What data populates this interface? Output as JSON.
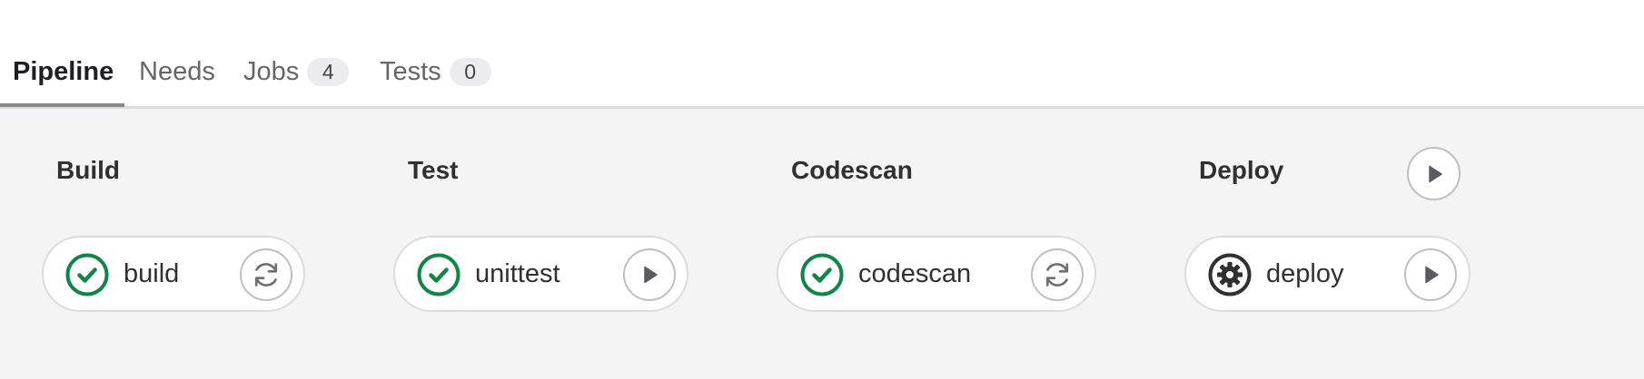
{
  "tabs": [
    {
      "label": "Pipeline",
      "active": true
    },
    {
      "label": "Needs"
    },
    {
      "label": "Jobs",
      "badge": "4"
    },
    {
      "label": "Tests",
      "badge": "0"
    }
  ],
  "stages": [
    {
      "title": "Build",
      "jobs": [
        {
          "name": "build",
          "status": "success",
          "status_icon": "check-circle-icon",
          "action_icon": "retry-icon"
        }
      ]
    },
    {
      "title": "Test",
      "jobs": [
        {
          "name": "unittest",
          "status": "success",
          "status_icon": "check-circle-icon",
          "action_icon": "play-icon"
        }
      ]
    },
    {
      "title": "Codescan",
      "jobs": [
        {
          "name": "codescan",
          "status": "success",
          "status_icon": "check-circle-icon",
          "action_icon": "retry-icon"
        }
      ]
    },
    {
      "title": "Deploy",
      "stage_action_icon": "play-icon",
      "jobs": [
        {
          "name": "deploy",
          "status": "manual",
          "status_icon": "gear-icon",
          "action_icon": "play-icon"
        }
      ]
    }
  ],
  "colors": {
    "success": "#108548",
    "manual": "#303030",
    "background": "#f4f4f4",
    "border": "#dcdcde",
    "active_underline": "#89888d"
  }
}
